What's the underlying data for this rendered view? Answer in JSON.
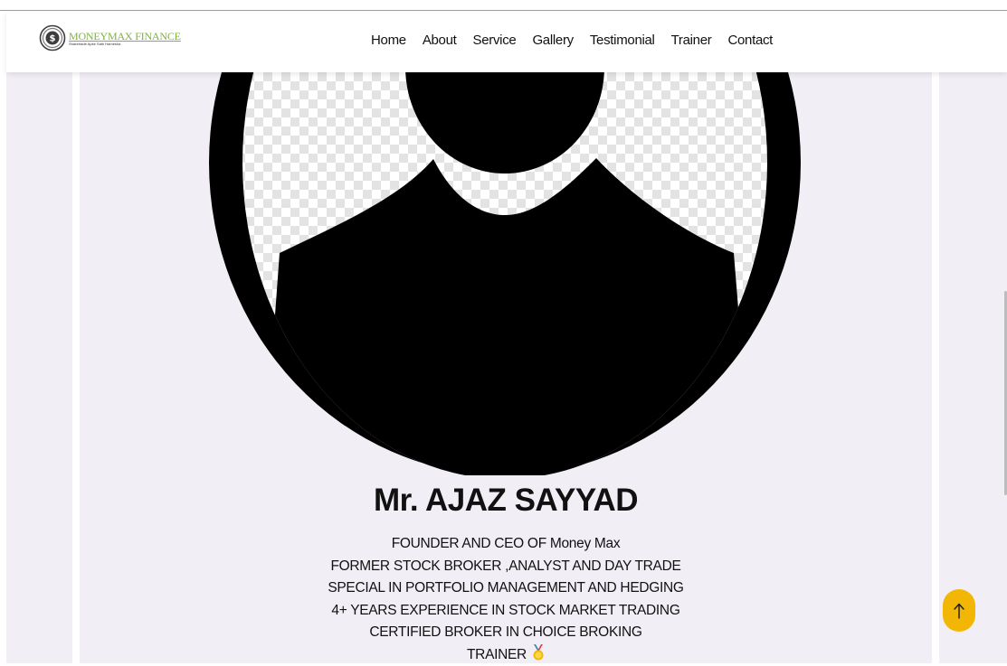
{
  "brand": {
    "name": "MONEYMAX FINANCE",
    "tagline": "Sharetrade Apke Sath Hamesha",
    "logo_icon": "dollar-spiral-icon",
    "accent_color": "#7fb241"
  },
  "nav": {
    "items": [
      {
        "label": "Home"
      },
      {
        "label": "About"
      },
      {
        "label": "Service"
      },
      {
        "label": "Gallery"
      },
      {
        "label": "Testimonial"
      },
      {
        "label": "Trainer"
      },
      {
        "label": "Contact"
      }
    ]
  },
  "profile": {
    "image_icon": "user-silhouette-icon",
    "name": "Mr. AJAZ SAYYAD",
    "lines": [
      "FOUNDER AND CEO OF Money Max",
      "FORMER STOCK BROKER ,ANALYST AND DAY TRADE",
      "SPECIAL IN PORTFOLIO MANAGEMENT AND HEDGING",
      "4+ YEARS EXPERIENCE IN STOCK MARKET TRADING",
      "CERTIFIED BROKER IN CHOICE BROKING"
    ],
    "last_line": "TRAINER",
    "medal_icon": "gold-medal-icon"
  },
  "back_to_top": {
    "icon": "arrow-up-icon",
    "color": "#f2b705"
  }
}
